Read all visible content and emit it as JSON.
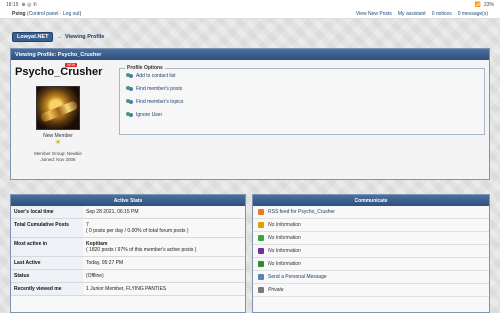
{
  "statusbar": {
    "time": "18:15",
    "indicators": "⊕ ◎ ✆",
    "battery": "23%"
  },
  "topbar": {
    "username": "Psing",
    "control_panel": "Control panel",
    "logout": "Log out",
    "links": [
      "View New Posts",
      "My assistant",
      "0 notices",
      "0 message(s)"
    ]
  },
  "breadcrumb": {
    "site": "Lowyat.NET",
    "current": "Viewing Profile"
  },
  "profile": {
    "header": "Viewing Profile: Psycho_Crusher",
    "username": "Psycho_Crusher",
    "badge": "NEW",
    "rank": "New Member",
    "member_group": "Member Group: Newbie",
    "joined": "Joined: Nov 2008",
    "options_title": "Profile Options",
    "options": [
      "Add to contact list",
      "Find member's posts",
      "Find member's topics",
      "Ignore User"
    ]
  },
  "active_stats": {
    "header": "Active Stats",
    "rows": [
      {
        "label": "User's local time",
        "value": "Sep 28 2021, 06:15 PM"
      },
      {
        "label": "Total Cumulative Posts",
        "value": "7",
        "sub": "( 0 posts per day / 0.00% of total forum posts )"
      },
      {
        "label": "Most active in",
        "value": "Kopitiam",
        "sub": "( 1820 posts / 97% of this member's active posts )"
      },
      {
        "label": "Last Active",
        "value": "Today, 05:27 PM"
      },
      {
        "label": "Status",
        "value": "(Offline)"
      },
      {
        "label": "Recently viewed me",
        "value": "1 Junior Member, FLYING PANTIES"
      }
    ]
  },
  "communicate": {
    "header": "Communicate",
    "rows": [
      {
        "text": "RSS feed for Psycho_Crusher",
        "icon": "rss-icon",
        "color": "#e87b22"
      },
      {
        "text": "No Information",
        "icon": "aim-icon",
        "color": "#d9a400"
      },
      {
        "text": "No Information",
        "icon": "msn-icon",
        "color": "#3aa640"
      },
      {
        "text": "No Information",
        "icon": "yahoo-icon",
        "color": "#6b2fa3"
      },
      {
        "text": "No Information",
        "icon": "icq-icon",
        "color": "#2f8b2f"
      },
      {
        "text": "Send a Personal Message",
        "icon": "message-icon",
        "color": "#5b83b8"
      },
      {
        "text": "Private",
        "icon": "lock-icon",
        "color": "#7a7a7a"
      }
    ]
  }
}
